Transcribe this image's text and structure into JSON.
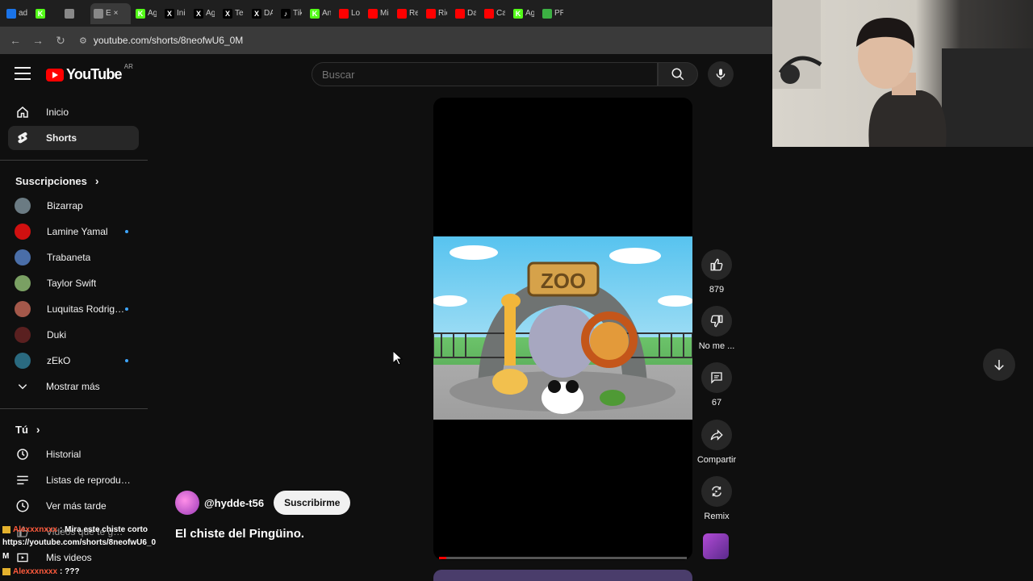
{
  "browser": {
    "tabs": [
      {
        "label": "adecks",
        "color": "#1a73e8",
        "glyph": "",
        "active": false
      },
      {
        "label": "",
        "color": "#53fc18",
        "glyph": "K",
        "active": false
      },
      {
        "label": "",
        "color": "#888888",
        "glyph": "",
        "active": false
      },
      {
        "label": "E",
        "color": "#888888",
        "glyph": "",
        "active": true
      },
      {
        "label": "Agr",
        "color": "#53fc18",
        "glyph": "K",
        "active": false
      },
      {
        "label": "Inic",
        "color": "#000000",
        "glyph": "X",
        "active": false
      },
      {
        "label": "Agu",
        "color": "#000000",
        "glyph": "X",
        "active": false
      },
      {
        "label": "Ten",
        "color": "#000000",
        "glyph": "X",
        "active": false
      },
      {
        "label": "DAV",
        "color": "#000000",
        "glyph": "X",
        "active": false
      },
      {
        "label": "TikT",
        "color": "#000000",
        "glyph": "♪",
        "active": false
      },
      {
        "label": "Anc",
        "color": "#53fc18",
        "glyph": "K",
        "active": false
      },
      {
        "label": "Los",
        "color": "#ff0000",
        "glyph": "",
        "active": false
      },
      {
        "label": "Mis",
        "color": "#ff0000",
        "glyph": "",
        "active": false
      },
      {
        "label": "Reil",
        "color": "#ff0000",
        "glyph": "",
        "active": false
      },
      {
        "label": "Rich",
        "color": "#ff0000",
        "glyph": "",
        "active": false
      },
      {
        "label": "Dad",
        "color": "#ff0000",
        "glyph": "",
        "active": false
      },
      {
        "label": "Can",
        "color": "#ff0000",
        "glyph": "",
        "active": false
      },
      {
        "label": "Agr",
        "color": "#53fc18",
        "glyph": "K",
        "active": false
      },
      {
        "label": "PRC",
        "color": "#3cb043",
        "glyph": "",
        "active": false
      }
    ],
    "url": "youtube.com/shorts/8neofwU6_0M"
  },
  "masthead": {
    "logo_text": "YouTube",
    "country_code": "AR",
    "search_placeholder": "Buscar"
  },
  "sidebar": {
    "main": [
      {
        "label": "Inicio",
        "icon": "home-icon"
      },
      {
        "label": "Shorts",
        "icon": "shorts-icon",
        "active": true
      }
    ],
    "subscriptions_header": "Suscripciones",
    "subscriptions": [
      {
        "label": "Bizarrap",
        "color": "#6b7b83",
        "new": false
      },
      {
        "label": "Lamine Yamal",
        "color": "#d01010",
        "new": true
      },
      {
        "label": "Trabaneta",
        "color": "#4a6ea8",
        "new": false
      },
      {
        "label": "Taylor Swift",
        "color": "#7aa063",
        "new": false
      },
      {
        "label": "Luquitas Rodriguez",
        "color": "#a4584a",
        "new": true
      },
      {
        "label": "Duki",
        "color": "#5a2020",
        "new": false
      },
      {
        "label": "zEkO",
        "color": "#2a6a80",
        "new": true
      }
    ],
    "show_more": "Mostrar más",
    "you_header": "Tú",
    "you_items": [
      {
        "label": "Historial",
        "icon": "history-icon"
      },
      {
        "label": "Listas de reproducción",
        "icon": "playlist-icon"
      },
      {
        "label": "Ver más tarde",
        "icon": "watch-later-icon"
      },
      {
        "label": "Videos que te gustan",
        "icon": "like-icon"
      },
      {
        "label": "Mis videos",
        "icon": "my-videos-icon"
      }
    ]
  },
  "short": {
    "thumbnail_sign": "ZOO",
    "channel_handle": "@hydde-t56",
    "subscribe_label": "Suscribirme",
    "title": "El chiste del Pingüino.",
    "progress": 0.03,
    "actions": [
      {
        "name": "like",
        "icon": "thumbs-up-icon",
        "label": "879"
      },
      {
        "name": "dislike",
        "icon": "thumbs-down-icon",
        "label": "No me ..."
      },
      {
        "name": "comments",
        "icon": "comment-icon",
        "label": "67"
      },
      {
        "name": "share",
        "icon": "share-icon",
        "label": "Compartir"
      },
      {
        "name": "remix",
        "icon": "remix-icon",
        "label": "Remix"
      }
    ]
  },
  "chat": [
    {
      "user": "Alexxxnxxx",
      "text": ": Mira este chiste corto"
    },
    {
      "user": "",
      "text": "https://youtube.com/shorts/8neofwU6_0"
    },
    {
      "user": "M",
      "text": ""
    },
    {
      "user": "Alexxxnxxx",
      "text": ": ???"
    }
  ]
}
